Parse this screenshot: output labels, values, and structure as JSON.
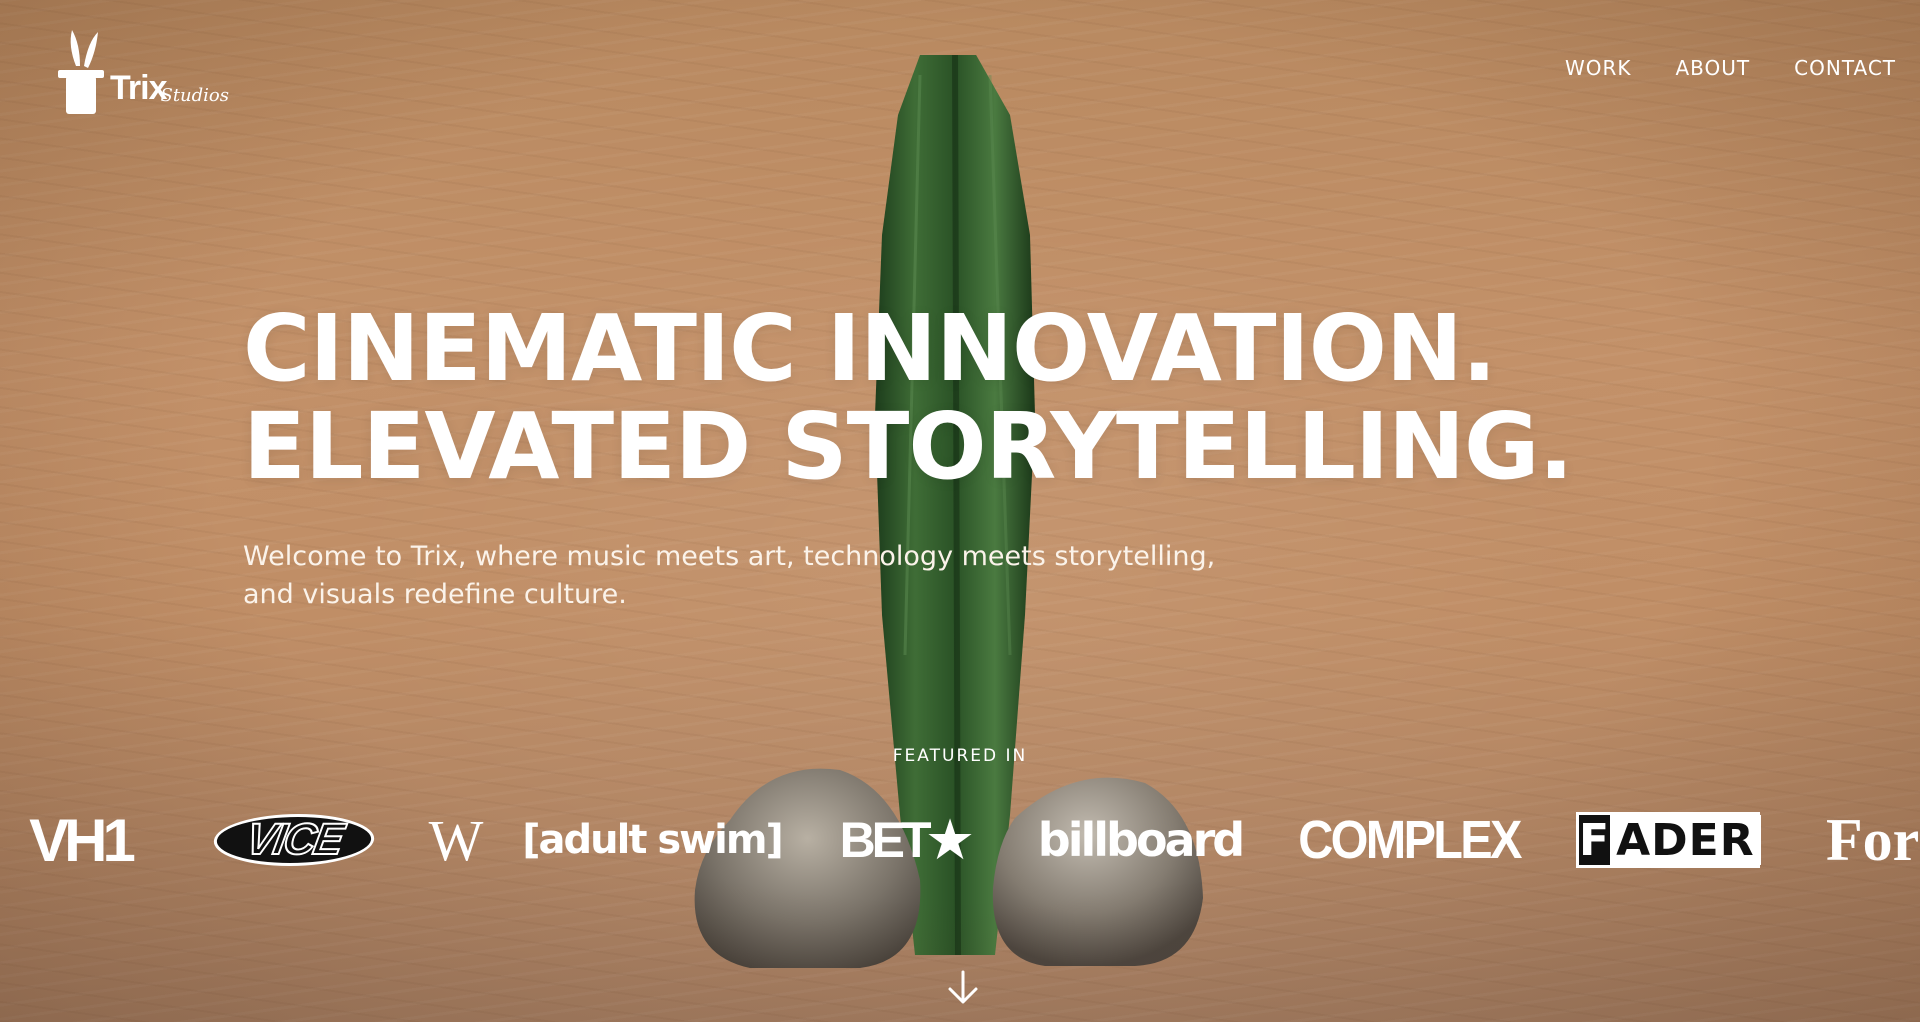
{
  "brand": {
    "name": "Trix",
    "sub": "Studios"
  },
  "nav": {
    "items": [
      {
        "label": "WORK"
      },
      {
        "label": "ABOUT"
      },
      {
        "label": "CONTACT"
      }
    ]
  },
  "hero": {
    "title_line1": "CINEMATIC INNOVATION.",
    "title_line2": "ELEVATED STORYTELLING.",
    "subtitle": "Welcome to Trix, where music meets art, technology meets storytelling, and visuals redefine culture."
  },
  "featured": {
    "label": "FEATURED IN",
    "logos": [
      {
        "name": "VH1",
        "text": "VH1"
      },
      {
        "name": "VICE",
        "text": "VICE"
      },
      {
        "name": "W",
        "text": "W"
      },
      {
        "name": "adult swim",
        "text": "[adult swim]"
      },
      {
        "name": "BET",
        "text": "BET★"
      },
      {
        "name": "billboard",
        "text": "billboard"
      },
      {
        "name": "COMPLEX",
        "text": "COMPLEX"
      },
      {
        "name": "FADER",
        "text_box": "F",
        "text_rest": "ADER"
      },
      {
        "name": "Forbes",
        "text": "For"
      }
    ]
  },
  "colors": {
    "background": "#b88a63",
    "text": "#ffffff",
    "cactus": "#2f5a2a"
  },
  "icons": {
    "logo": "top-hat-rabbit-icon",
    "scroll": "arrow-down-icon"
  }
}
